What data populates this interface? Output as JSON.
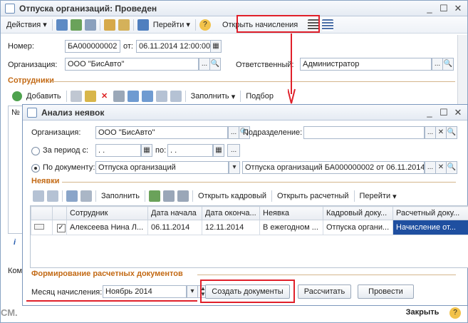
{
  "back": {
    "title": "Отпуска организаций: Проведен",
    "toolbar": {
      "actions": "Действия",
      "goto": "Перейти",
      "help": "?",
      "open_accruals": "Открыть начисления"
    },
    "number_label": "Номер:",
    "number_value": "БА000000002",
    "from_label": "от:",
    "date_value": "06.11.2014 12:00:00",
    "org_label": "Организация:",
    "org_value": "ООО \"БисАвто\"",
    "resp_label": "Ответственный:",
    "resp_value": "Администратор",
    "employees_section": "Сотрудники",
    "emp_toolbar": {
      "add": "Добавить",
      "fill": "Заполнить",
      "select": "Подбор"
    },
    "col_no": "№",
    "com_label": "Ком",
    "close": "Закрыть",
    "help2": "?",
    "info": "i"
  },
  "watermark": "СМ.",
  "front": {
    "title": "Анализ неявок",
    "org_label": "Организация:",
    "org_value": "ООО \"БисАвто\"",
    "dept_label": "Подразделение:",
    "dept_value": "",
    "period_label": "За период с:",
    "period_from": ". .",
    "po_label": "по:",
    "period_to": ". .",
    "by_doc_label": "По документу:",
    "doc_type": "Отпуска организаций",
    "doc_value": "Отпуска организаций БА000000002 от 06.11.2014",
    "absences_section": "Неявки",
    "tb": {
      "fill": "Заполнить",
      "open_hr": "Открыть кадровый",
      "open_calc": "Открыть расчетный",
      "goto": "Перейти"
    },
    "columns": [
      "Сотрудник",
      "Дата начала",
      "Дата оконча...",
      "Неявка",
      "Кадровый доку...",
      "Расчетный доку..."
    ],
    "rows": [
      {
        "employee": "Алексеева Нина Л...",
        "start": "06.11.2014",
        "end": "12.11.2014",
        "absence": "В ежегодном ...",
        "hr_doc": "Отпуска органи...",
        "calc_doc": "Начисление от..."
      }
    ],
    "calc_section": "Формирование расчетных документов",
    "month_label": "Месяц начисления:",
    "month_value": "Ноябрь 2014",
    "create_docs": "Создать документы",
    "calculate": "Рассчитать",
    "post": "Провести"
  },
  "colors": {
    "accent_red": "#e0202a",
    "section_orange": "#c36a15",
    "selection": "#1f4fa0"
  }
}
